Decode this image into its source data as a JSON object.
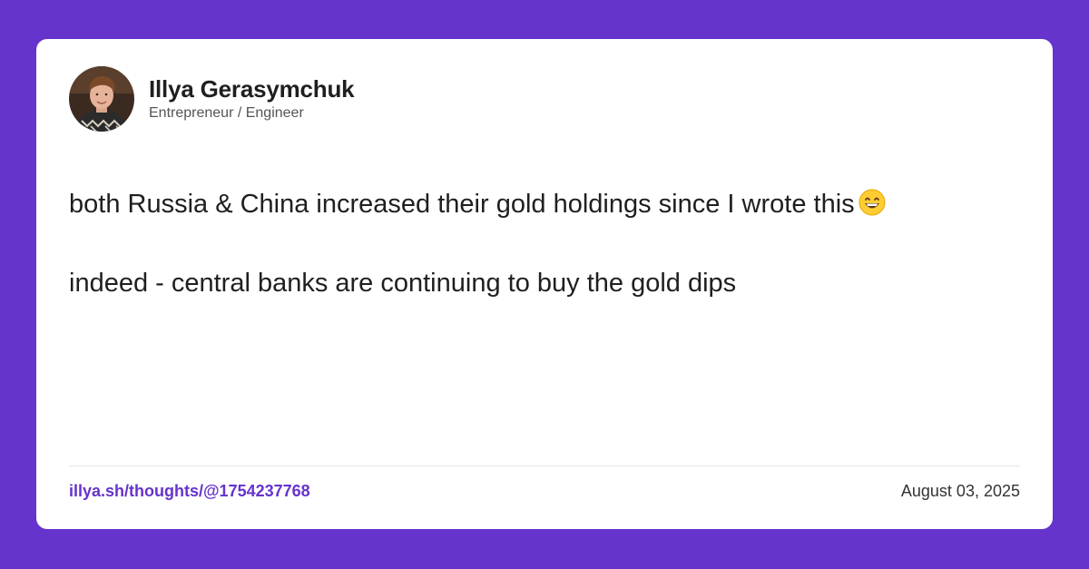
{
  "colors": {
    "background": "#6633cc",
    "card": "#ffffff",
    "accent_link": "#6633cc",
    "text": "#1f1f1f"
  },
  "author": {
    "name": "Illya Gerasymchuk",
    "role": "Entrepreneur / Engineer",
    "avatar_icon": "avatar-photo"
  },
  "post": {
    "line1": "both Russia & China increased their gold holdings since I wrote this",
    "line1_emoji": "grinning-face-with-smiling-eyes-icon",
    "line2": "indeed - central banks are continuing to buy the gold dips"
  },
  "footer": {
    "link": "illya.sh/thoughts/@1754237768",
    "date": "August 03, 2025"
  }
}
